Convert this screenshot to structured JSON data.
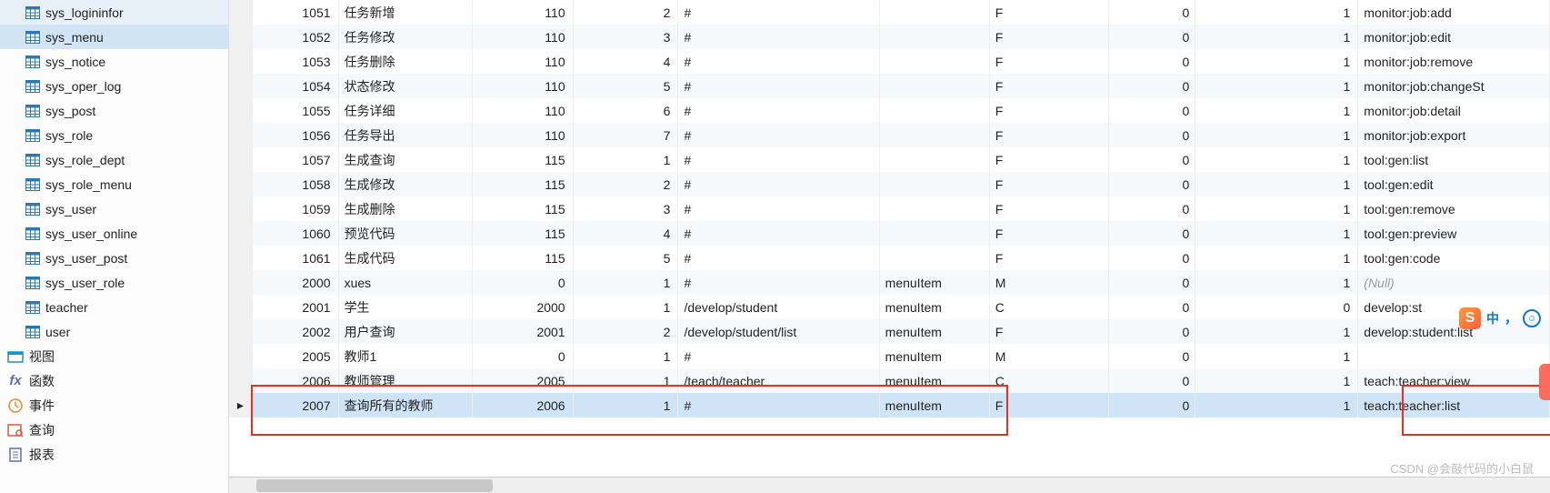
{
  "sidebar": {
    "tables": [
      {
        "id": "sys_logininfor",
        "label": "sys_logininfor"
      },
      {
        "id": "sys_menu",
        "label": "sys_menu",
        "selected": true
      },
      {
        "id": "sys_notice",
        "label": "sys_notice"
      },
      {
        "id": "sys_oper_log",
        "label": "sys_oper_log"
      },
      {
        "id": "sys_post",
        "label": "sys_post"
      },
      {
        "id": "sys_role",
        "label": "sys_role"
      },
      {
        "id": "sys_role_dept",
        "label": "sys_role_dept"
      },
      {
        "id": "sys_role_menu",
        "label": "sys_role_menu"
      },
      {
        "id": "sys_user",
        "label": "sys_user"
      },
      {
        "id": "sys_user_online",
        "label": "sys_user_online"
      },
      {
        "id": "sys_user_post",
        "label": "sys_user_post"
      },
      {
        "id": "sys_user_role",
        "label": "sys_user_role"
      },
      {
        "id": "teacher",
        "label": "teacher"
      },
      {
        "id": "user",
        "label": "user"
      }
    ],
    "categories": [
      {
        "id": "views",
        "label": "视图",
        "icon": "view-icon",
        "color": "#1e90c9"
      },
      {
        "id": "functions",
        "label": "函数",
        "icon": "fx-icon",
        "color": "#5f6caf"
      },
      {
        "id": "events",
        "label": "事件",
        "icon": "clock-icon",
        "color": "#e78b2f"
      },
      {
        "id": "queries",
        "label": "查询",
        "icon": "query-icon",
        "color": "#d05f3f"
      },
      {
        "id": "reports",
        "label": "报表",
        "icon": "report-icon",
        "color": "#5f6caf"
      }
    ]
  },
  "grid": {
    "null_label": "(Null)",
    "rows": [
      {
        "id": "1051",
        "name": "任务新增",
        "parent": "110",
        "order": "2",
        "url": "#",
        "target": "",
        "type": "F",
        "visible": "0",
        "refresh": "1",
        "perm": "monitor:job:add"
      },
      {
        "id": "1052",
        "name": "任务修改",
        "parent": "110",
        "order": "3",
        "url": "#",
        "target": "",
        "type": "F",
        "visible": "0",
        "refresh": "1",
        "perm": "monitor:job:edit"
      },
      {
        "id": "1053",
        "name": "任务删除",
        "parent": "110",
        "order": "4",
        "url": "#",
        "target": "",
        "type": "F",
        "visible": "0",
        "refresh": "1",
        "perm": "monitor:job:remove"
      },
      {
        "id": "1054",
        "name": "状态修改",
        "parent": "110",
        "order": "5",
        "url": "#",
        "target": "",
        "type": "F",
        "visible": "0",
        "refresh": "1",
        "perm": "monitor:job:changeSt"
      },
      {
        "id": "1055",
        "name": "任务详细",
        "parent": "110",
        "order": "6",
        "url": "#",
        "target": "",
        "type": "F",
        "visible": "0",
        "refresh": "1",
        "perm": "monitor:job:detail"
      },
      {
        "id": "1056",
        "name": "任务导出",
        "parent": "110",
        "order": "7",
        "url": "#",
        "target": "",
        "type": "F",
        "visible": "0",
        "refresh": "1",
        "perm": "monitor:job:export"
      },
      {
        "id": "1057",
        "name": "生成查询",
        "parent": "115",
        "order": "1",
        "url": "#",
        "target": "",
        "type": "F",
        "visible": "0",
        "refresh": "1",
        "perm": "tool:gen:list"
      },
      {
        "id": "1058",
        "name": "生成修改",
        "parent": "115",
        "order": "2",
        "url": "#",
        "target": "",
        "type": "F",
        "visible": "0",
        "refresh": "1",
        "perm": "tool:gen:edit"
      },
      {
        "id": "1059",
        "name": "生成删除",
        "parent": "115",
        "order": "3",
        "url": "#",
        "target": "",
        "type": "F",
        "visible": "0",
        "refresh": "1",
        "perm": "tool:gen:remove"
      },
      {
        "id": "1060",
        "name": "预览代码",
        "parent": "115",
        "order": "4",
        "url": "#",
        "target": "",
        "type": "F",
        "visible": "0",
        "refresh": "1",
        "perm": "tool:gen:preview"
      },
      {
        "id": "1061",
        "name": "生成代码",
        "parent": "115",
        "order": "5",
        "url": "#",
        "target": "",
        "type": "F",
        "visible": "0",
        "refresh": "1",
        "perm": "tool:gen:code"
      },
      {
        "id": "2000",
        "name": "xues",
        "parent": "0",
        "order": "1",
        "url": "#",
        "target": "menuItem",
        "type": "M",
        "visible": "0",
        "refresh": "1",
        "perm": null
      },
      {
        "id": "2001",
        "name": "学生",
        "parent": "2000",
        "order": "1",
        "url": "/develop/student",
        "target": "menuItem",
        "type": "C",
        "visible": "0",
        "refresh": "0",
        "perm": "develop:st"
      },
      {
        "id": "2002",
        "name": "用户查询",
        "parent": "2001",
        "order": "2",
        "url": "/develop/student/list",
        "target": "menuItem",
        "type": "F",
        "visible": "0",
        "refresh": "1",
        "perm": "develop:student:list"
      },
      {
        "id": "2005",
        "name": "教师1",
        "parent": "0",
        "order": "1",
        "url": "#",
        "target": "menuItem",
        "type": "M",
        "visible": "0",
        "refresh": "1",
        "perm": ""
      },
      {
        "id": "2006",
        "name": "教师管理",
        "parent": "2005",
        "order": "1",
        "url": "/teach/teacher",
        "target": "menuItem",
        "type": "C",
        "visible": "0",
        "refresh": "1",
        "perm": "teach:teacher:view"
      },
      {
        "id": "2007",
        "name": "查询所有的教师",
        "parent": "2006",
        "order": "1",
        "url": "#",
        "target": "menuItem",
        "type": "F",
        "visible": "0",
        "refresh": "1",
        "perm": "teach:teacher:list",
        "selected": true
      }
    ]
  },
  "ime": {
    "zh": "中",
    "comma": "，",
    "smile": "☺"
  },
  "watermark": "CSDN @会敲代码的小白鼠"
}
